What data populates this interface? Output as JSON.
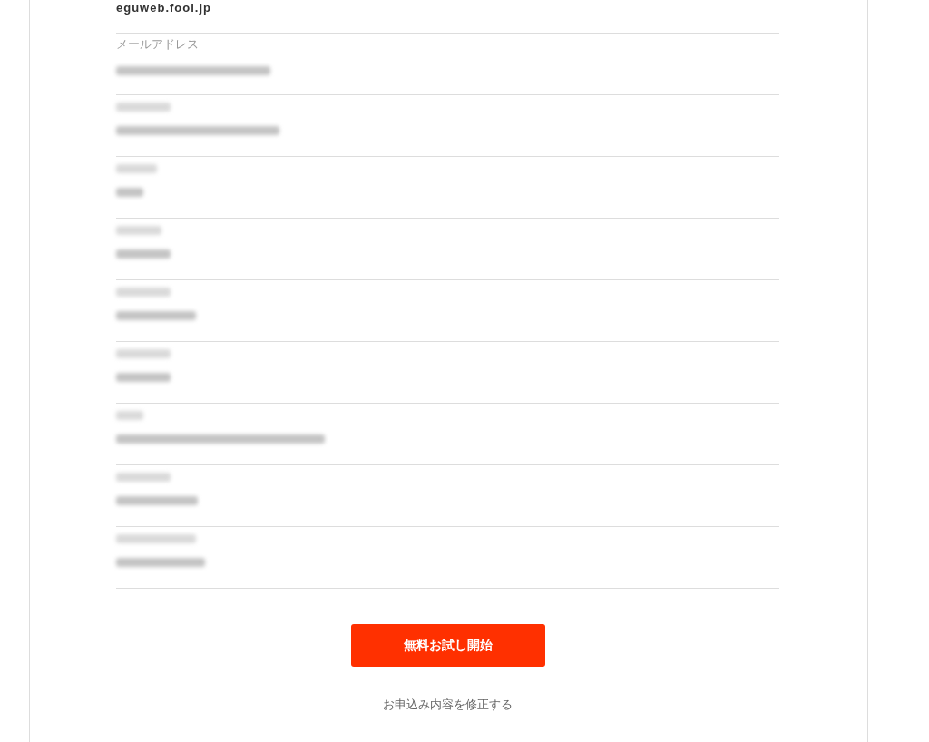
{
  "site": {
    "domain": "eguweb.fool.jp"
  },
  "fields": [
    {
      "label": "メールアドレス",
      "label_blurred": false,
      "value_blurred": true
    },
    {
      "label_blurred": true,
      "value_blurred": true
    },
    {
      "label_blurred": true,
      "value_blurred": true
    },
    {
      "label_blurred": true,
      "value_blurred": true
    },
    {
      "label_blurred": true,
      "value_blurred": true
    },
    {
      "label_blurred": true,
      "value_blurred": true
    },
    {
      "label_blurred": true,
      "value_blurred": true
    },
    {
      "label_blurred": true,
      "value_blurred": true
    },
    {
      "label_blurred": true,
      "value_blurred": true
    }
  ],
  "submit_button": {
    "label": "無料お試し開始"
  },
  "edit_link": {
    "label": "お申込み内容を修正する"
  }
}
